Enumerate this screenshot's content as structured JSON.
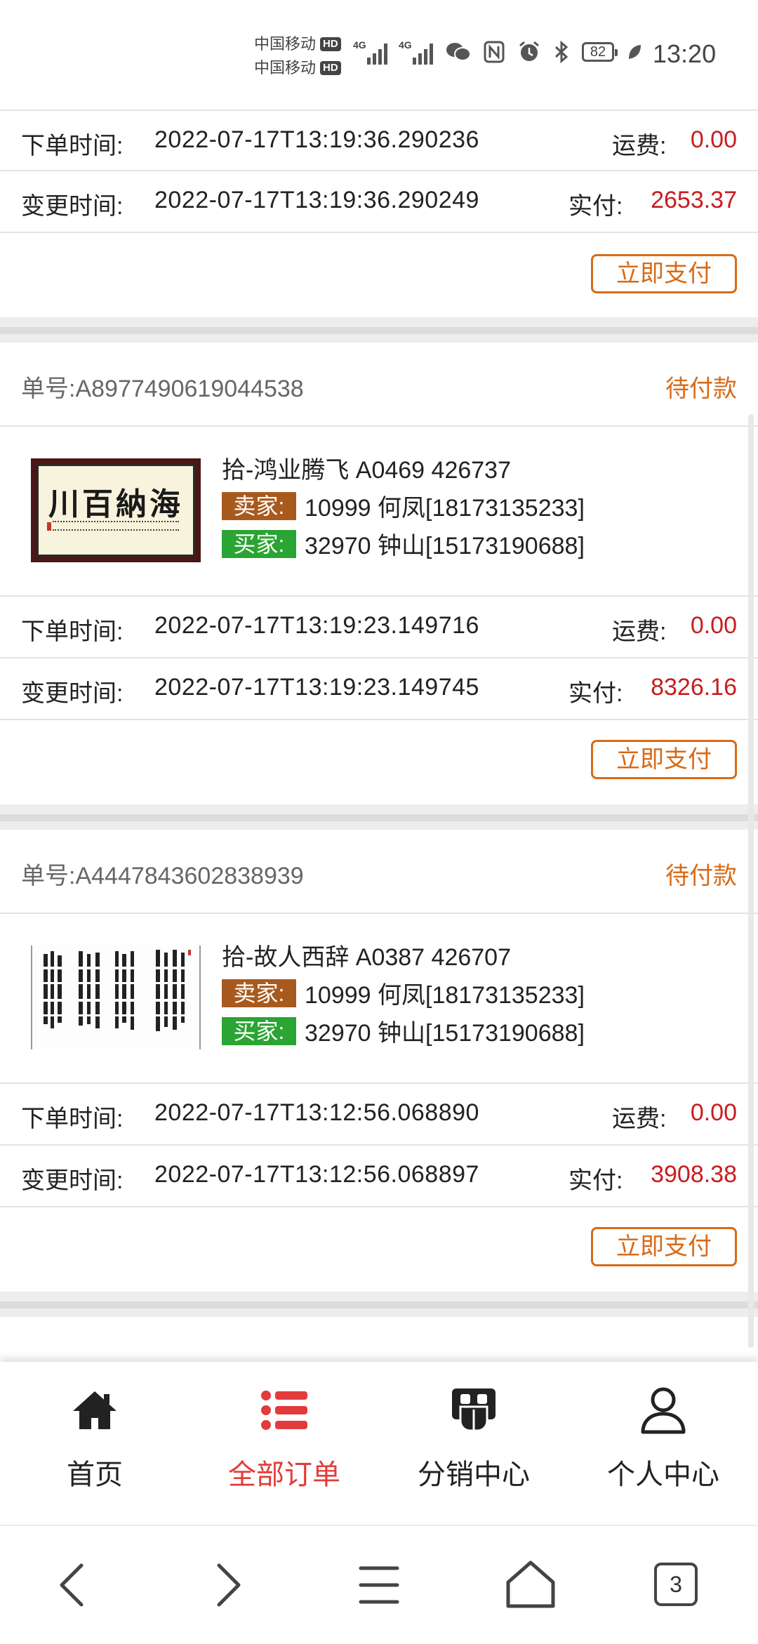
{
  "status_bar": {
    "carrier1": "中国移动",
    "carrier2": "中国移动",
    "hd": "HD",
    "network": "4G",
    "battery": "82",
    "time": "13:20"
  },
  "labels": {
    "order_time": "下单时间:",
    "change_time": "变更时间:",
    "freight": "运费:",
    "paid": "实付:",
    "pay_now": "立即支付",
    "order_no": "单号:",
    "seller": "卖家:",
    "buyer": "买家:"
  },
  "partial_order": {
    "order_time": "2022-07-17T13:19:36.290236",
    "change_time": "2022-07-17T13:19:36.290249",
    "freight": "0.00",
    "paid": "2653.37"
  },
  "orders": [
    {
      "order_no": "A8977490619044538",
      "status": "待付款",
      "product_title": "拾-鸿业腾飞 A0469 426737",
      "seller": "10999 何凤[18173135233]",
      "buyer": "32970 钟山[15173190688]",
      "order_time": "2022-07-17T13:19:23.149716",
      "change_time": "2022-07-17T13:19:23.149745",
      "freight": "0.00",
      "paid": "8326.16",
      "calligraphy_text": "海納百川"
    },
    {
      "order_no": "A4447843602838939",
      "status": "待付款",
      "product_title": "拾-故人西辞 A0387 426707",
      "seller": "10999 何凤[18173135233]",
      "buyer": "32970 钟山[15173190688]",
      "order_time": "2022-07-17T13:12:56.068890",
      "change_time": "2022-07-17T13:12:56.068897",
      "freight": "0.00",
      "paid": "3908.38"
    }
  ],
  "tabbar": {
    "home": "首页",
    "all_orders": "全部订单",
    "distribution": "分销中心",
    "personal": "个人中心"
  },
  "system_nav": {
    "tabs_count": "3"
  },
  "colors": {
    "accent_orange": "#d86a17",
    "price_red": "#c81d1d",
    "active_tab_red": "#e33b3b",
    "seller_tag": "#a85a1e",
    "buyer_tag": "#2aa432"
  }
}
